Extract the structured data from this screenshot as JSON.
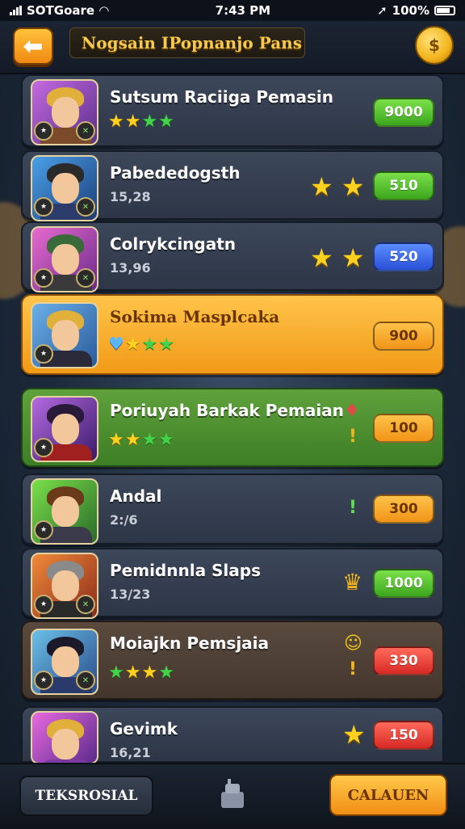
{
  "status_bar": {
    "carrier": "SOTGoare",
    "time": "7:43 PM",
    "battery": "100%"
  },
  "header": {
    "title": "Nogsain IPopnanjo Pans",
    "back_icon": "arrow-left-icon",
    "coin_icon": "coin-icon"
  },
  "players": [
    {
      "name": "Sutsum Raciiga Pemasin",
      "stars": 4,
      "price": "9000",
      "price_color": "green",
      "style": "dark"
    },
    {
      "name": "Pabededogsth",
      "sub": "15,28",
      "right_stars": 2,
      "price": "510",
      "price_color": "green",
      "style": "dark"
    },
    {
      "name": "Colrykcingatn",
      "sub": "13,96",
      "right_stars": 2,
      "price": "520",
      "price_color": "blue",
      "style": "dark"
    },
    {
      "name": "Sokima Masplcaka",
      "stars": 4,
      "price": "900",
      "price_color": "orange",
      "style": "orange"
    },
    {
      "name": "Poriuyah Barkak Pemaian",
      "stars": 4,
      "price": "100",
      "price_color": "orange",
      "style": "green"
    },
    {
      "name": "Andal",
      "sub": "2:/6",
      "price": "300",
      "price_color": "orange",
      "style": "dark"
    },
    {
      "name": "Pemidnnla Slaps",
      "sub": "13/23",
      "price": "1000",
      "price_color": "green",
      "style": "dark"
    },
    {
      "name": "Moiajkn Pemsjaia",
      "stars": 4,
      "price": "330",
      "price_color": "red",
      "style": "brown"
    },
    {
      "name": "Gevimk",
      "sub": "16,21",
      "right_stars": 1,
      "price": "150",
      "price_color": "red",
      "style": "dark"
    }
  ],
  "footer": {
    "left_button": "TEKSROSIAL",
    "right_button": "CALAUEN",
    "mid_icon": "character-icon"
  }
}
